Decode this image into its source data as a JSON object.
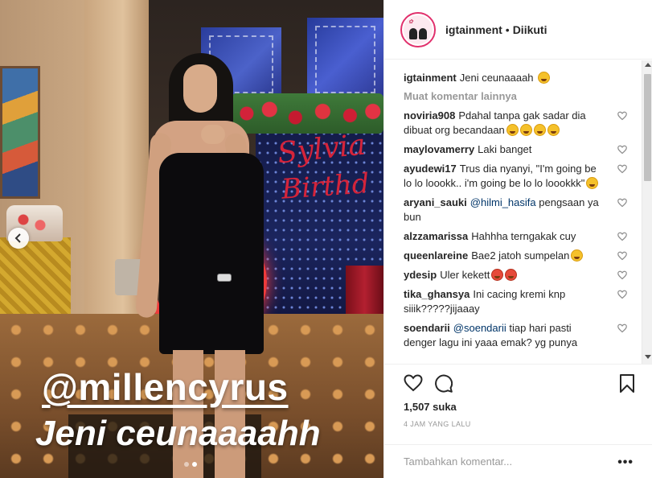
{
  "post": {
    "caption_overlay_handle": "@millencyrus",
    "caption_overlay_text": "Jeni ceunaaaahh",
    "backdrop_script_1": "Sylvia",
    "backdrop_script_2": "Birthd",
    "slides": {
      "total": 2,
      "current": 2
    }
  },
  "header": {
    "username": "igtainment",
    "separator": "•",
    "follow_status": "Diikuti"
  },
  "caption": {
    "username": "igtainment",
    "text": "Jeni ceunaaaah"
  },
  "load_more": "Muat komentar lainnya",
  "comments": [
    {
      "user": "noviria908",
      "text": "Pdahal tanpa gak sadar dia dibuat org becandaan",
      "emoji_count": 4,
      "emoji_color": "yellow"
    },
    {
      "user": "maylovamerry",
      "text": "Laki banget",
      "emoji_count": 0
    },
    {
      "user": "ayudewi17",
      "text": "Trus dia nyanyi, \"I'm going be lo lo loookk.. i'm going be lo lo loookkk\"",
      "emoji_count": 1,
      "emoji_color": "yellow"
    },
    {
      "user": "aryani_sauki",
      "mention": "@hilmi_hasifa",
      "text": "pengsaan ya bun",
      "emoji_count": 0
    },
    {
      "user": "alzzamarissa",
      "text": "Hahhha terngakak cuy",
      "emoji_count": 0
    },
    {
      "user": "queenlareine",
      "text": "Bae2 jatoh sumpelan",
      "emoji_count": 1,
      "emoji_color": "yellow"
    },
    {
      "user": "ydesip",
      "text": "Uler kekett",
      "emoji_count": 2,
      "emoji_color": "red"
    },
    {
      "user": "tika_ghansya",
      "text": "Ini cacing kremi knp siiik?????jijaaay",
      "emoji_count": 0
    },
    {
      "user": "soendarii",
      "mention": "@soendarii",
      "text": "tiap hari pasti denger lagu ini yaaa emak? yg punya",
      "emoji_count": 0
    }
  ],
  "likes": "1,507 suka",
  "time_ago": "4 JAM YANG LALU",
  "add_comment": {
    "placeholder": "Tambahkan komentar..."
  },
  "more_label": "•••",
  "colors": {
    "accent_ring": "#e1306c",
    "mention": "#003569",
    "muted": "#999999"
  }
}
